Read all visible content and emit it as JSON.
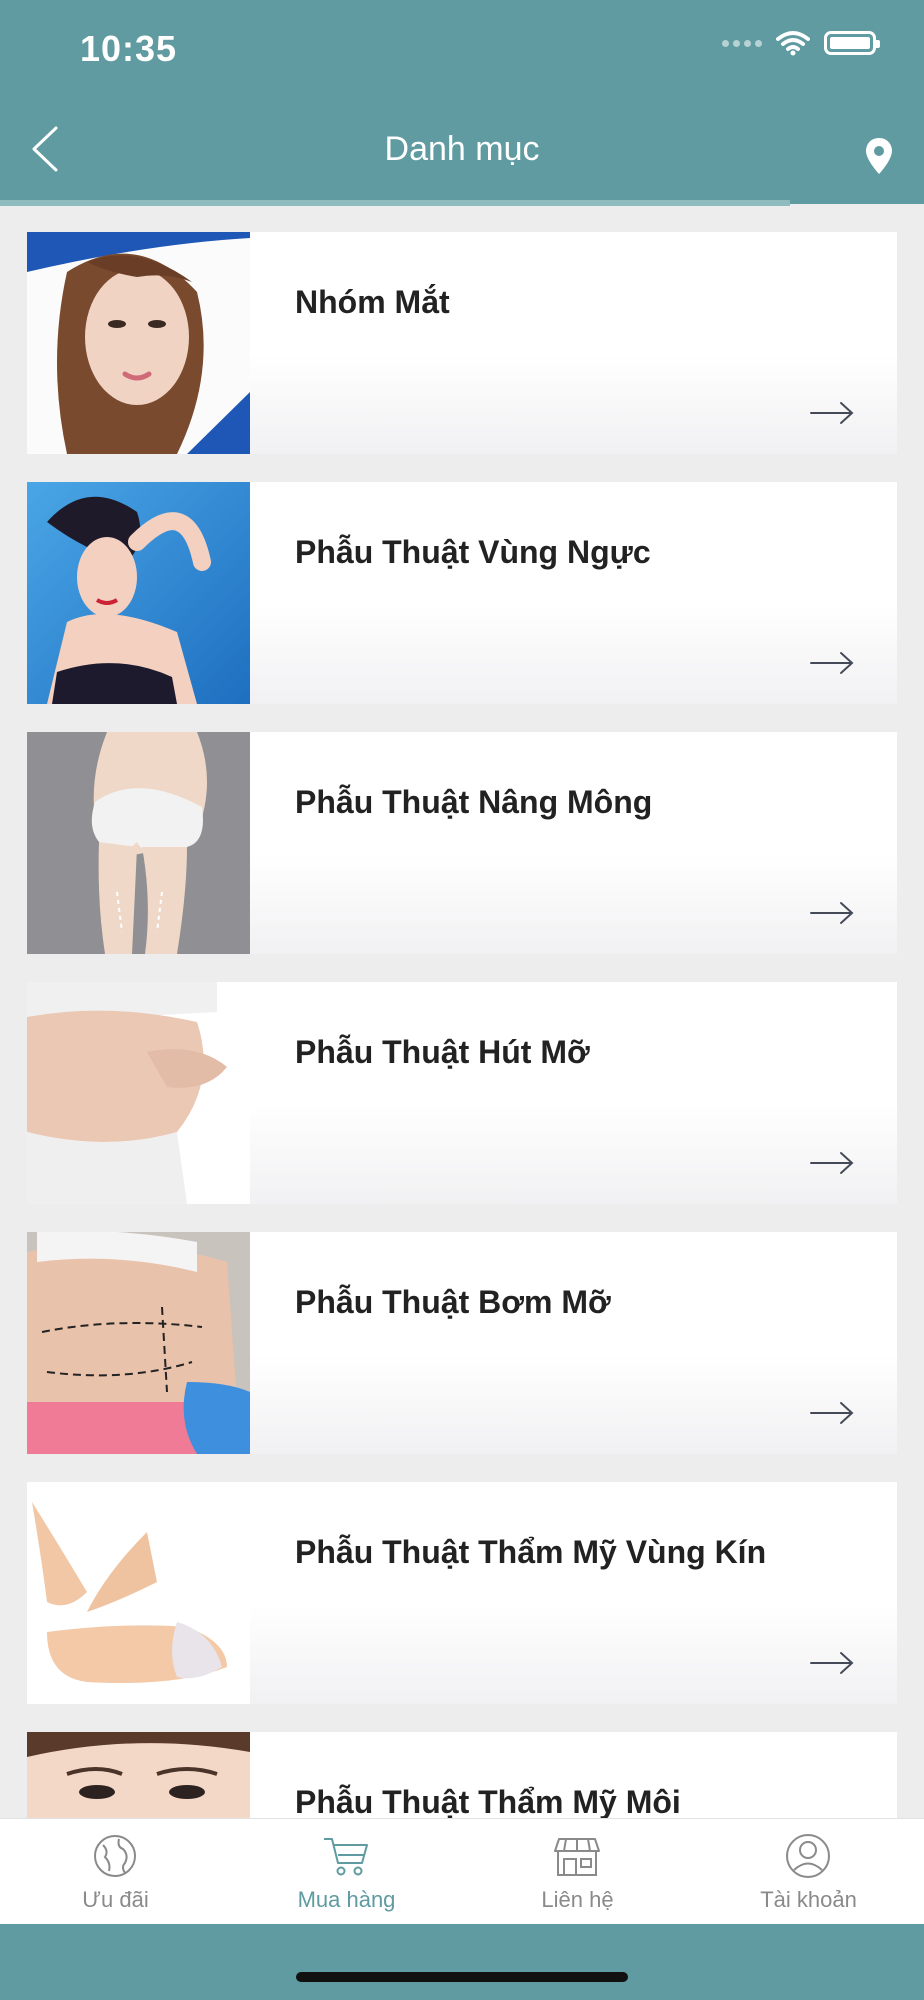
{
  "status_bar": {
    "time": "10:35"
  },
  "header": {
    "title": "Danh mục"
  },
  "categories": [
    {
      "label": "Nhóm Mắt",
      "image": "woman-face-portrait"
    },
    {
      "label": "Phẫu Thuật Vùng Ngực",
      "image": "woman-posing-blue-background"
    },
    {
      "label": "Phẫu Thuật Nâng Mông",
      "image": "buttocks-lift-markings"
    },
    {
      "label": "Phẫu Thuật Hút Mỡ",
      "image": "belly-pinch"
    },
    {
      "label": "Phẫu Thuật Bơm Mỡ",
      "image": "abdomen-surgical-markings"
    },
    {
      "label": "Phẫu Thuật Thẩm Mỹ Vùng Kín",
      "image": "legs-lying-pose"
    },
    {
      "label": "Phẫu Thuật Thẩm Mỹ Môi",
      "image": "woman-eyes-closeup"
    }
  ],
  "tabbar": {
    "tabs": [
      {
        "label": "Ưu đãi",
        "icon": "globe-icon",
        "active": false
      },
      {
        "label": "Mua hàng",
        "icon": "cart-icon",
        "active": true
      },
      {
        "label": "Liên hệ",
        "icon": "store-icon",
        "active": false
      },
      {
        "label": "Tài khoản",
        "icon": "user-icon",
        "active": false
      }
    ]
  },
  "colors": {
    "primary": "#5f9ba0",
    "tab_inactive": "#8a8a8a",
    "text": "#222222"
  }
}
